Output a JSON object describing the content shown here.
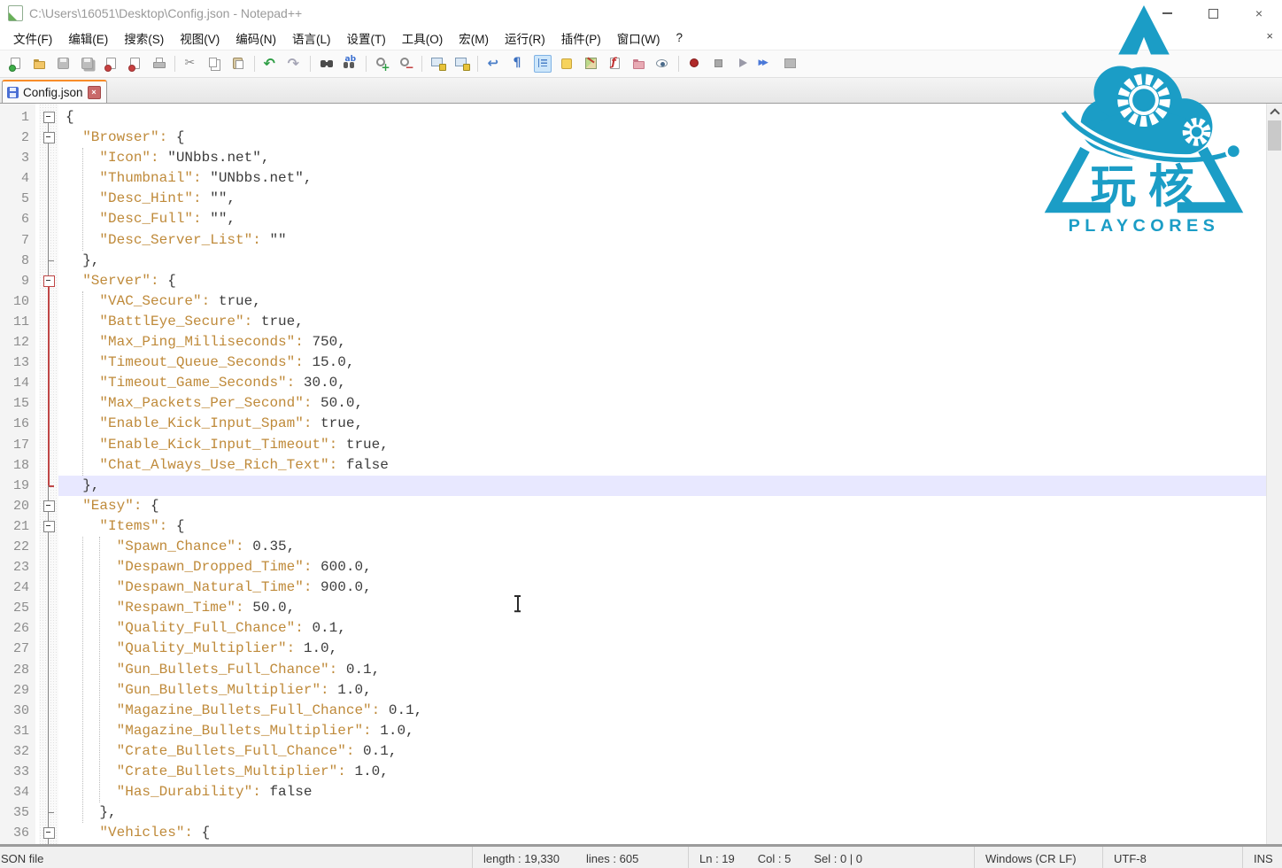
{
  "window": {
    "title": "C:\\Users\\16051\\Desktop\\Config.json - Notepad++",
    "controls": [
      "minimize-icon",
      "maximize-icon",
      "close-icon"
    ]
  },
  "menubar": {
    "items": [
      "文件(F)",
      "编辑(E)",
      "搜索(S)",
      "视图(V)",
      "编码(N)",
      "语言(L)",
      "设置(T)",
      "工具(O)",
      "宏(M)",
      "运行(R)",
      "插件(P)",
      "窗口(W)",
      "?"
    ],
    "close_icon": "close-document-icon"
  },
  "toolbar": {
    "icons": [
      "new-file",
      "open",
      "save",
      "save-all",
      "close",
      "close-all",
      "print",
      "sep",
      "cut",
      "copy",
      "paste",
      "sep",
      "undo",
      "redo",
      "sep",
      "find",
      "replace",
      "sep",
      "zoom-in",
      "zoom-out",
      "sep",
      "sync-v-scroll",
      "sync-h-scroll",
      "sep",
      "word-wrap",
      "show-all-chars",
      "indent-guide",
      "udl-dialog",
      "doc-map",
      "function-list",
      "folder-workspace",
      "file-monitoring",
      "sep",
      "macro-record",
      "macro-stop",
      "macro-play",
      "macro-run-multiple",
      "macro-save"
    ]
  },
  "tabbar": {
    "tabs": [
      {
        "label": "Config.json",
        "saved": true,
        "active": true
      }
    ]
  },
  "editor": {
    "current_line": 19,
    "lines": [
      {
        "n": 1,
        "t": "{"
      },
      {
        "n": 2,
        "t": "  \"Browser\": {"
      },
      {
        "n": 3,
        "t": "    \"Icon\": \"UNbbs.net\","
      },
      {
        "n": 4,
        "t": "    \"Thumbnail\": \"UNbbs.net\","
      },
      {
        "n": 5,
        "t": "    \"Desc_Hint\": \"\","
      },
      {
        "n": 6,
        "t": "    \"Desc_Full\": \"\","
      },
      {
        "n": 7,
        "t": "    \"Desc_Server_List\": \"\""
      },
      {
        "n": 8,
        "t": "  },"
      },
      {
        "n": 9,
        "t": "  \"Server\": {"
      },
      {
        "n": 10,
        "t": "    \"VAC_Secure\": true,"
      },
      {
        "n": 11,
        "t": "    \"BattlEye_Secure\": true,"
      },
      {
        "n": 12,
        "t": "    \"Max_Ping_Milliseconds\": 750,"
      },
      {
        "n": 13,
        "t": "    \"Timeout_Queue_Seconds\": 15.0,"
      },
      {
        "n": 14,
        "t": "    \"Timeout_Game_Seconds\": 30.0,"
      },
      {
        "n": 15,
        "t": "    \"Max_Packets_Per_Second\": 50.0,"
      },
      {
        "n": 16,
        "t": "    \"Enable_Kick_Input_Spam\": true,"
      },
      {
        "n": 17,
        "t": "    \"Enable_Kick_Input_Timeout\": true,"
      },
      {
        "n": 18,
        "t": "    \"Chat_Always_Use_Rich_Text\": false"
      },
      {
        "n": 19,
        "t": "  },"
      },
      {
        "n": 20,
        "t": "  \"Easy\": {"
      },
      {
        "n": 21,
        "t": "    \"Items\": {"
      },
      {
        "n": 22,
        "t": "      \"Spawn_Chance\": 0.35,"
      },
      {
        "n": 23,
        "t": "      \"Despawn_Dropped_Time\": 600.0,"
      },
      {
        "n": 24,
        "t": "      \"Despawn_Natural_Time\": 900.0,"
      },
      {
        "n": 25,
        "t": "      \"Respawn_Time\": 50.0,"
      },
      {
        "n": 26,
        "t": "      \"Quality_Full_Chance\": 0.1,"
      },
      {
        "n": 27,
        "t": "      \"Quality_Multiplier\": 1.0,"
      },
      {
        "n": 28,
        "t": "      \"Gun_Bullets_Full_Chance\": 0.1,"
      },
      {
        "n": 29,
        "t": "      \"Gun_Bullets_Multiplier\": 1.0,"
      },
      {
        "n": 30,
        "t": "      \"Magazine_Bullets_Full_Chance\": 0.1,"
      },
      {
        "n": 31,
        "t": "      \"Magazine_Bullets_Multiplier\": 1.0,"
      },
      {
        "n": 32,
        "t": "      \"Crate_Bullets_Full_Chance\": 0.1,"
      },
      {
        "n": 33,
        "t": "      \"Crate_Bullets_Multiplier\": 1.0,"
      },
      {
        "n": 34,
        "t": "      \"Has_Durability\": false"
      },
      {
        "n": 35,
        "t": "    },"
      },
      {
        "n": 36,
        "t": "    \"Vehicles\": {"
      }
    ],
    "fold_markers": {
      "1": "box",
      "2": "box",
      "8": "end",
      "9": "box-red",
      "19": "end-red",
      "20": "box",
      "21": "box",
      "35": "end",
      "36": "box"
    },
    "indent_guides": [
      {
        "col": 2,
        "from": 3,
        "to": 7
      },
      {
        "col": 2,
        "from": 10,
        "to": 18
      },
      {
        "col": 2,
        "from": 22,
        "to": 35
      },
      {
        "col": 4,
        "from": 22,
        "to": 34
      }
    ]
  },
  "statusbar": {
    "doc_type": "SON file",
    "length": "length : 19,330",
    "lines": "lines : 605",
    "ln": "Ln : 19",
    "col": "Col : 5",
    "sel": "Sel : 0 | 0",
    "eol": "Windows (CR LF)",
    "encoding": "UTF-8",
    "insert_mode": "INS"
  },
  "watermark": {
    "cn": "玩核",
    "en": "PLAYCORES"
  },
  "colors": {
    "logo_cyan": "#1b9dc6",
    "tab_accent": "#f88c28",
    "json_key": "#bf8a3a",
    "value_text": "#3c3c3c",
    "current_line_bg": "#e8e8ff",
    "fold_active": "#c04646"
  }
}
